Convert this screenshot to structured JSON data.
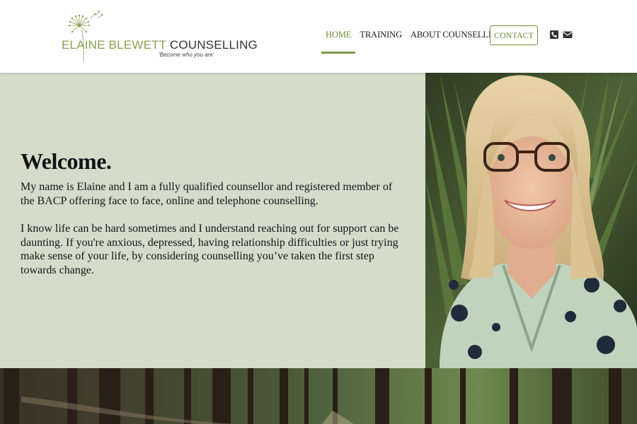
{
  "brand": {
    "name_first": "ELAINE BLEWETT",
    "name_second": " COUNSELLING",
    "tagline": "'Become who you are'",
    "logo_icon": "dandelion-icon",
    "accent_color": "#6f8c33"
  },
  "nav": {
    "items": [
      {
        "label": "HOME",
        "active": true
      },
      {
        "label": "TRAINING",
        "active": false
      },
      {
        "label": "ABOUT COUNSELLING",
        "active": false
      }
    ],
    "contact_label": "CONTACT",
    "icons": [
      "phone-icon",
      "mail-icon"
    ]
  },
  "hero": {
    "heading": "Welcome.",
    "paragraph1": "My name is Elaine and I am a fully qualified counsellor and registered member of the BACP offering face to face, online and telephone counselling.",
    "paragraph2": "I know life can be hard sometimes and I understand reaching out for support can be daunting. If you're anxious, depressed, having relationship difficulties or just trying make sense of your life, by considering counselling you’ve taken the first step towards change.",
    "background_color": "#d6dcca"
  }
}
